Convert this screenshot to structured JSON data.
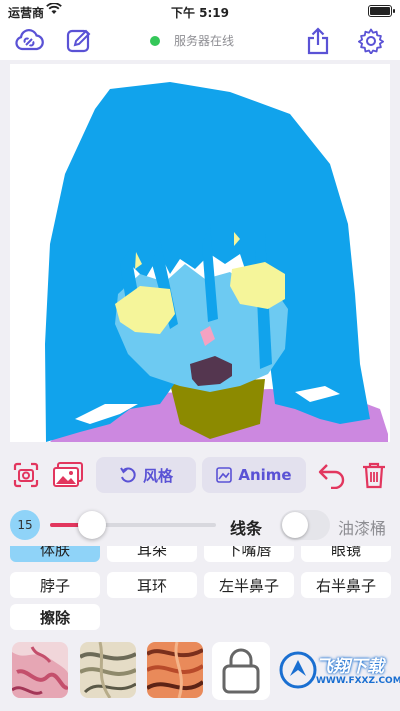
{
  "status_bar": {
    "carrier": "运营商",
    "time": "下午 5:19"
  },
  "toolbar": {
    "icons": [
      "cloud-link-icon",
      "edit-icon",
      "share-icon",
      "settings-icon"
    ],
    "server_status": "服务器在线",
    "server_status_color": "#34c759"
  },
  "actions": {
    "style_label": "风格",
    "anime_label": "Anime",
    "accent_color": "#5a52d5",
    "danger_color": "#e2365e"
  },
  "brush": {
    "size": "15",
    "level": 0.25,
    "line_label": "线条",
    "bucket_label": "油漆桶",
    "bucket_enabled": false
  },
  "parts": {
    "row1": [
      "体肤",
      "耳朵",
      "下嘴唇",
      "眼镜"
    ],
    "row2": [
      "脖子",
      "耳环",
      "左半鼻子",
      "右半鼻子"
    ],
    "row3": [
      "擦除"
    ],
    "selected": "体肤"
  },
  "watermark": {
    "title": "飞翔下载",
    "url": "WWW.FXXZ.COM"
  }
}
